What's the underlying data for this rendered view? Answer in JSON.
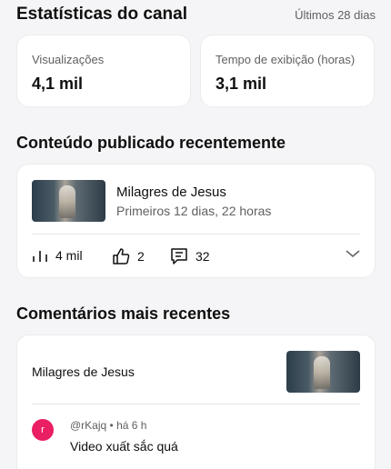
{
  "header": {
    "title": "Estatísticas do canal",
    "period": "Últimos 28 dias"
  },
  "stats": [
    {
      "label": "Visualizações",
      "value": "4,1 mil"
    },
    {
      "label": "Tempo de exibição (horas)",
      "value": "3,1 mil"
    }
  ],
  "recent_content": {
    "section_title": "Conteúdo publicado recentemente",
    "video_title": "Milagres de Jesus",
    "video_meta": "Primeiros 12 dias, 22 horas",
    "views": "4 mil",
    "likes": "2",
    "comments": "32"
  },
  "recent_comments": {
    "section_title": "Comentários mais recentes",
    "video_title": "Milagres de Jesus",
    "comment": {
      "avatar_letter": "r",
      "author_meta": "@rKajq • há 6 h",
      "text": "Video xuất sắc quá"
    }
  },
  "icons": {
    "views": "bar-chart-icon",
    "likes": "thumbs-up-icon",
    "comments": "comment-icon",
    "expand": "chevron-down-icon"
  },
  "colors": {
    "avatar": "#e91e63",
    "secondary_text": "#606060"
  }
}
